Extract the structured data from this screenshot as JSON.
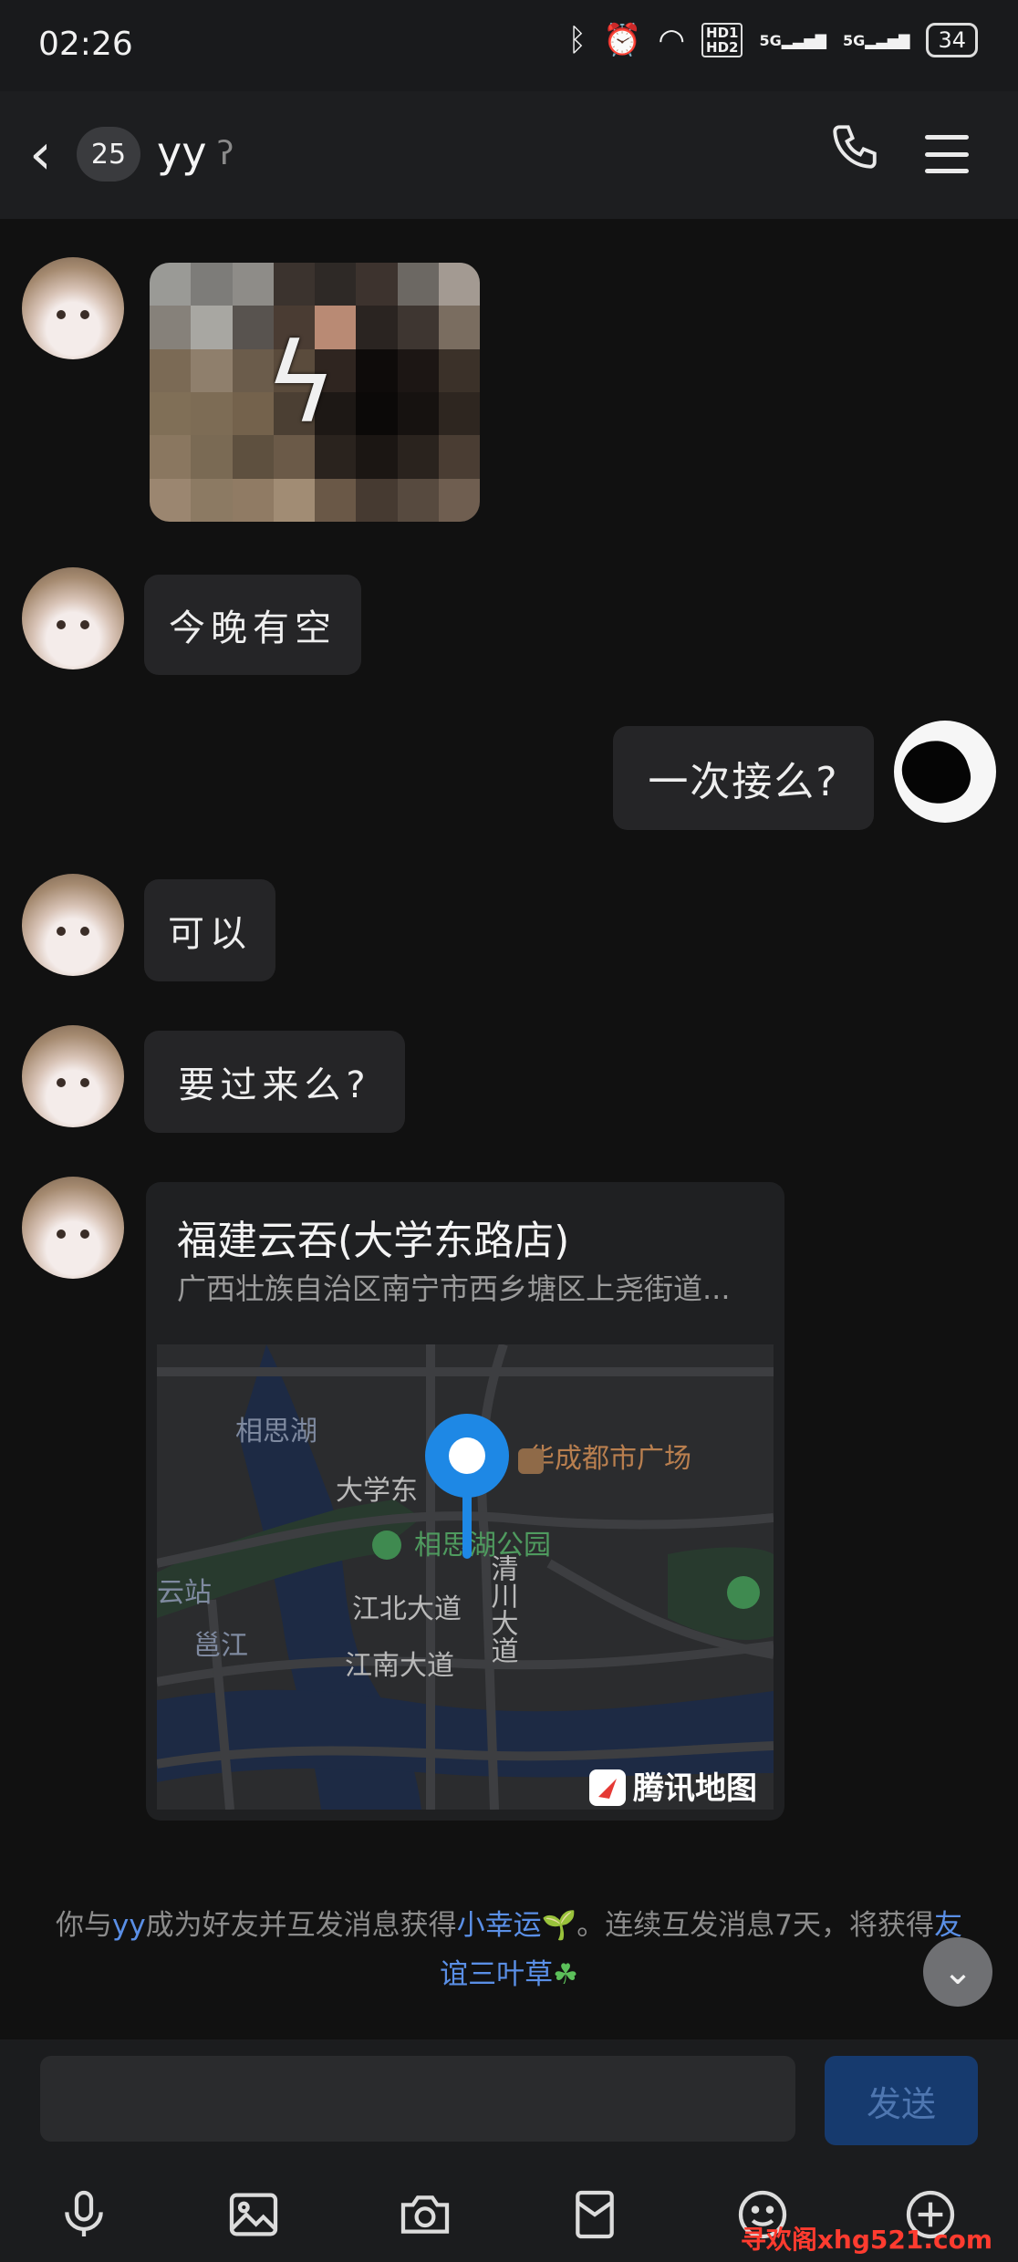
{
  "status_bar": {
    "time": "02:26",
    "hd1": "HD1",
    "hd2": "HD2",
    "sig1": "5G",
    "sig2": "5G",
    "battery": "34"
  },
  "header": {
    "unread_count": "25",
    "contact_name": "yy"
  },
  "messages": [
    {
      "from": "contact",
      "type": "image"
    },
    {
      "from": "contact",
      "type": "text",
      "text": "今晚有空"
    },
    {
      "from": "me",
      "type": "text",
      "text": "一次接么?"
    },
    {
      "from": "contact",
      "type": "text",
      "text": "可以"
    },
    {
      "from": "contact",
      "type": "text",
      "text": "要过来么?"
    },
    {
      "from": "contact",
      "type": "location",
      "title": "福建云吞(大学东路店)",
      "address": "广西壮族自治区南宁市西乡塘区上尧街道...",
      "map_labels": {
        "lake": "相思湖",
        "mall": "华成都市广场",
        "road1": "大学东",
        "park": "相思湖公园",
        "station": "云站",
        "jiangbei": "江北大道",
        "qingchuan": "清川大道",
        "yongjiang": "邕江",
        "jiangnan": "江南大道"
      },
      "map_brand": "腾讯地图"
    }
  ],
  "notice": {
    "part1": "你与",
    "name": "yy",
    "part2": "成为好友并互发消息获得",
    "reward1": "小幸运",
    "part3": "。连续互发消息7天，将获得",
    "reward2": "友谊三叶草"
  },
  "composer": {
    "input_value": "",
    "send_label": "发送"
  },
  "toolbar_icons": [
    "microphone-icon",
    "image-icon",
    "camera-icon",
    "red-packet-icon",
    "emoji-icon",
    "plus-icon"
  ],
  "watermark": "寻欢阁xhg521.com"
}
